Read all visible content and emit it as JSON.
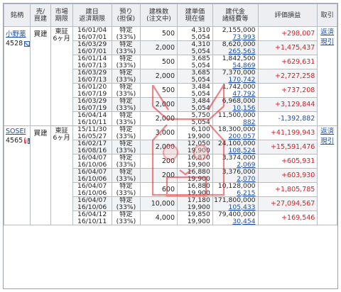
{
  "headers": {
    "name": [
      "銘柄"
    ],
    "type": [
      "売/",
      "買建"
    ],
    "market": [
      "市場",
      "期限"
    ],
    "date": [
      "建日",
      "返済期限"
    ],
    "deposit": [
      "預り",
      "(担保)"
    ],
    "qty": [
      "建株数",
      "(注文中)"
    ],
    "price": [
      "建単価",
      "現在値"
    ],
    "cost": [
      "建代金",
      "諸経費等"
    ],
    "pl": [
      "評価損益"
    ],
    "trade": [
      "取引"
    ]
  },
  "stocks": [
    {
      "name": "小野薬",
      "code": "4528",
      "has_alert": false,
      "type": "買建",
      "market": [
        "東証",
        "6ヶ月"
      ],
      "trade": [
        "返済",
        "現引"
      ],
      "rows": [
        {
          "d1": "16/01/04",
          "d2": "16/07/01",
          "dep1": "特定",
          "dep2": "(33%)",
          "qty": "500",
          "p1": "4,310",
          "p2": "5,054",
          "c1": "2,155,000",
          "c2": "73,993",
          "pl": "+298,007",
          "sign": "pos"
        },
        {
          "d1": "16/03/29",
          "d2": "16/07/01",
          "dep1": "特定",
          "dep2": "(33%)",
          "qty": "2,000",
          "p1": "4,310",
          "p2": "5,054",
          "c1": "8,620,000",
          "c2": "265,563",
          "pl": "+1,475,437",
          "sign": "pos"
        },
        {
          "d1": "16/01/14",
          "d2": "16/07/13",
          "dep1": "特定",
          "dep2": "(33%)",
          "qty": "500",
          "p1": "3,685",
          "p2": "5,054",
          "c1": "1,842,500",
          "c2": "54,869",
          "pl": "+629,631",
          "sign": "pos"
        },
        {
          "d1": "16/03/29",
          "d2": "16/07/13",
          "dep1": "特定",
          "dep2": "(33%)",
          "qty": "2,000",
          "p1": "3,685",
          "p2": "5,054",
          "c1": "7,370,000",
          "c2": "170,742",
          "pl": "+2,727,258",
          "sign": "pos"
        },
        {
          "d1": "16/01/20",
          "d2": "16/07/19",
          "dep1": "特定",
          "dep2": "(33%)",
          "qty": "500",
          "p1": "3,484",
          "p2": "5,054",
          "c1": "1,742,000",
          "c2": "47,792",
          "pl": "+737,208",
          "sign": "pos"
        },
        {
          "d1": "16/03/29",
          "d2": "16/07/19",
          "dep1": "特定",
          "dep2": "(33%)",
          "qty": "2,000",
          "p1": "3,484",
          "p2": "5,054",
          "c1": "6,968,000",
          "c2": "10,156",
          "pl": "+3,129,844",
          "sign": "pos"
        },
        {
          "d1": "16/04/14",
          "d2": "16/10/11",
          "dep1": "特定",
          "dep2": "(33%)",
          "qty": "2,000",
          "p1": "5,750",
          "p2": "5,054",
          "c1": "11,500,000",
          "c2": "882",
          "pl": "-1,392,882",
          "sign": "neg"
        }
      ]
    },
    {
      "name": "SOSEI",
      "code": "4565",
      "has_alert": true,
      "type": "買建",
      "market": [
        "東証",
        "6ヶ月"
      ],
      "trade": [
        "返済",
        "現引"
      ],
      "rows": [
        {
          "d1": "15/11/30",
          "d2": "16/05/27",
          "dep1": "特定",
          "dep2": "(33%)",
          "qty": "3,000",
          "p1": "6,100",
          "p2": "19,900",
          "c1": "18,300,000",
          "c2": "200,057",
          "pl": "+41,199,943",
          "sign": "pos"
        },
        {
          "d1": "16/02/17",
          "d2": "16/08/16",
          "dep1": "特定",
          "dep2": "(33%)",
          "qty": "2,000",
          "p1": "12,050",
          "p2": "19,900",
          "c1": "24,100,000",
          "c2": "108,524",
          "pl": "+15,591,476",
          "sign": "pos"
        },
        {
          "d1": "16/04/07",
          "d2": "16/10/06",
          "dep1": "特定",
          "dep2": "(33%)",
          "qty": "200",
          "p1": "16,870",
          "p2": "19,900",
          "c1": "3,374,000",
          "c2": "2,069",
          "pl": "+605,931",
          "sign": "pos"
        },
        {
          "d1": "16/04/07",
          "d2": "16/10/06",
          "dep1": "特定",
          "dep2": "(33%)",
          "qty": "200",
          "p1": "16,880",
          "p2": "19,900",
          "c1": "3,376,000",
          "c2": "2,070",
          "pl": "+603,930",
          "sign": "pos"
        },
        {
          "d1": "16/04/07",
          "d2": "16/10/06",
          "dep1": "特定",
          "dep2": "(33%)",
          "qty": "600",
          "p1": "16,880",
          "p2": "19,900",
          "c1": "10,128,000",
          "c2": "6,215",
          "pl": "+1,805,785",
          "sign": "pos"
        },
        {
          "d1": "16/04/07",
          "d2": "16/10/06",
          "dep1": "特定",
          "dep2": "(33%)",
          "qty": "10,000",
          "p1": "17,180",
          "p2": "19,900",
          "c1": "171,800,000",
          "c2": "105,433",
          "pl": "+27,094,567",
          "sign": "pos"
        },
        {
          "d1": "16/04/12",
          "d2": "16/10/11",
          "dep1": "特定",
          "dep2": "(33%)",
          "qty": "4,000",
          "p1": "19,850",
          "p2": "19,900",
          "c1": "79,400,000",
          "c2": "30,454",
          "pl": "+169,546",
          "sign": "pos"
        }
      ]
    }
  ],
  "colors": {
    "positive": "#e8141e",
    "negative": "#1a4fa8",
    "link": "#1a4fa8",
    "header_bg": "#eceef1",
    "stamp": "#e0232a"
  },
  "icons": [
    "mail-icon",
    "alert-icon",
    "stamp-watermark"
  ]
}
